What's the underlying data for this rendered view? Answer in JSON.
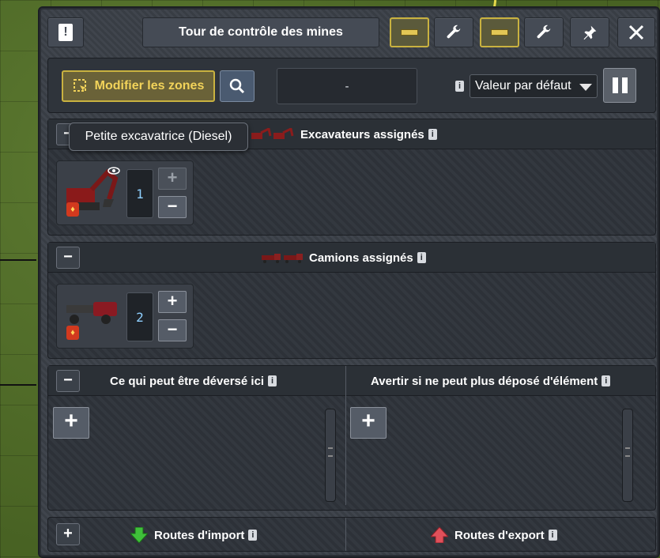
{
  "window": {
    "title": "Tour de contrôle des mines",
    "buttons": {
      "info_icon": "info-icon",
      "wrench_icon": "wrench-icon",
      "pin_icon": "pin-icon",
      "close_icon": "close-icon",
      "accent_color": "#c9b240"
    }
  },
  "toolbar": {
    "modify_zones_label": "Modifier les zones",
    "search_icon": "search-icon",
    "zone_value": "-",
    "preset_select": {
      "selected": "Valeur par défaut"
    },
    "pause_icon": "pause-icon"
  },
  "tooltip": {
    "text": "Petite excavatrice (Diesel)"
  },
  "excavators": {
    "heading": "Excavateurs assignés",
    "count": "1"
  },
  "trucks": {
    "heading": "Camions assignés",
    "count": "2"
  },
  "dumping": {
    "left_heading": "Ce qui peut être déversé ici",
    "right_heading": "Avertir si ne peut plus déposé d'élément"
  },
  "routes": {
    "import_label": "Routes d'import",
    "export_label": "Routes d'export",
    "import_color": "#3fbf3a",
    "export_color": "#e0505a"
  }
}
